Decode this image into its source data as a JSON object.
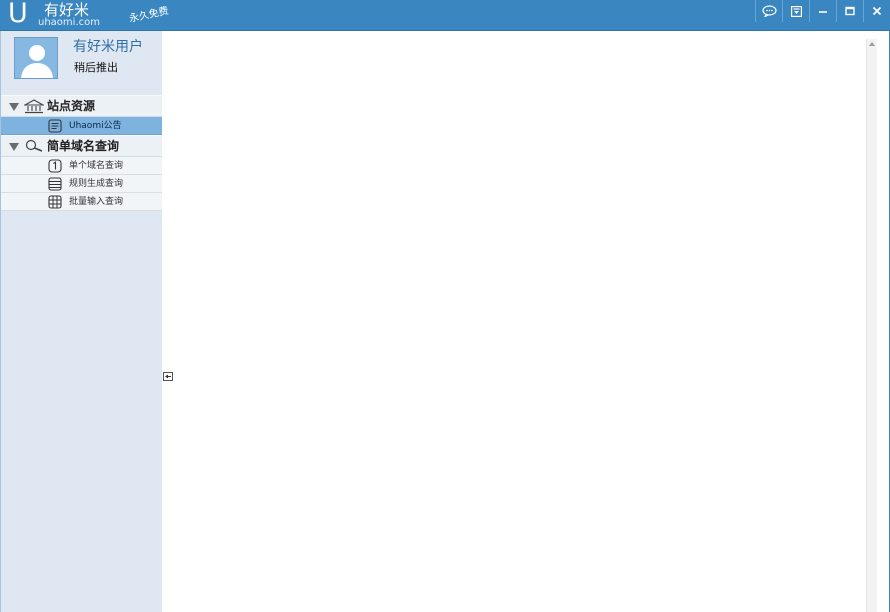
{
  "app": {
    "logo_letter": "U",
    "name": "有好米",
    "domain": "uhaomi.com",
    "slogan": "永久免费"
  },
  "window_controls": [
    "chat-icon",
    "menu-dropdown-icon",
    "minimize-icon",
    "maximize-icon",
    "close-icon"
  ],
  "user": {
    "name": "有好米用户",
    "action": "稍后推出"
  },
  "sidebar": {
    "groups": [
      {
        "label": "站点资源",
        "icon": "bank-icon",
        "items": [
          {
            "label": "Uhaomi公告",
            "icon": "notice-icon",
            "selected": true
          }
        ]
      },
      {
        "label": "简单域名查询",
        "icon": "magnifier-icon",
        "items": [
          {
            "label": "单个域名查询",
            "icon": "number-one-icon",
            "selected": false
          },
          {
            "label": "规则生成查询",
            "icon": "list-icon",
            "selected": false
          },
          {
            "label": "批量输入查询",
            "icon": "grid-icon",
            "selected": false
          }
        ]
      }
    ]
  },
  "colors": {
    "titlebar": "#3a86c0",
    "sidebar_bg": "#dfe8f2",
    "selected_item": "#7eb3e0",
    "user_name": "#2f6fa6"
  }
}
